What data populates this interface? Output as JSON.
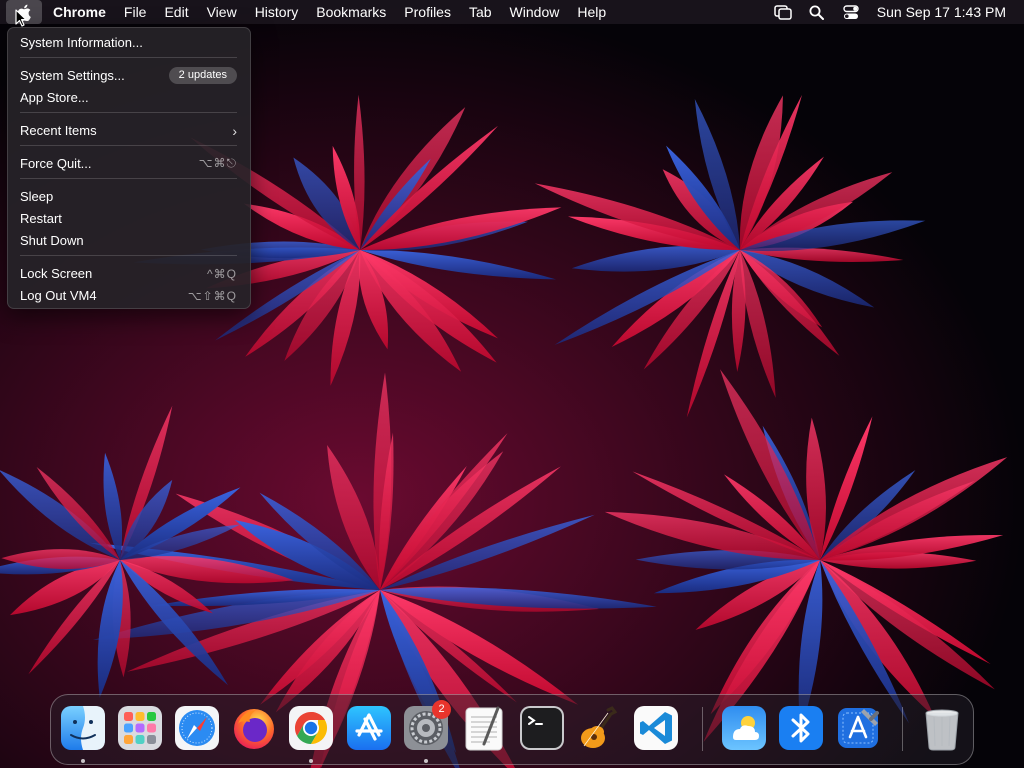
{
  "menubar": {
    "apple_icon": "apple-logo-icon",
    "app_name": "Chrome",
    "items": [
      "File",
      "Edit",
      "View",
      "History",
      "Bookmarks",
      "Profiles",
      "Tab",
      "Window",
      "Help"
    ],
    "status_icons": [
      "screen-mirroring-icon",
      "spotlight-search-icon",
      "control-center-icon"
    ],
    "clock": "Sun Sep 17  1:43 PM"
  },
  "apple_menu": {
    "system_information": "System Information...",
    "system_settings": "System Settings...",
    "updates_badge": "2 updates",
    "app_store": "App Store...",
    "recent_items": "Recent Items",
    "force_quit": "Force Quit...",
    "force_quit_shortcut": "⌥⌘⎋",
    "sleep": "Sleep",
    "restart": "Restart",
    "shut_down": "Shut Down",
    "lock_screen": "Lock Screen",
    "lock_screen_shortcut": "^⌘Q",
    "log_out": "Log Out VM4",
    "log_out_shortcut": "⌥⇧⌘Q"
  },
  "dock": {
    "apps": [
      "Finder",
      "Launchpad",
      "Safari",
      "Firefox",
      "Google Chrome",
      "App Store",
      "System Settings",
      "TextEdit",
      "Terminal",
      "GarageBand",
      "Visual Studio Code",
      "Weather",
      "Bluetooth File Exchange",
      "Xcode",
      "Trash"
    ],
    "running": [
      "Finder",
      "Google Chrome",
      "System Settings"
    ],
    "system_settings_badge": "2"
  },
  "colors": {
    "menubar_bg": "#1c161e",
    "menu_bg": "#262228",
    "accent_red": "#e8342c",
    "wallpaper_red": "#ff1a4a",
    "wallpaper_blue": "#2a4fd0"
  }
}
